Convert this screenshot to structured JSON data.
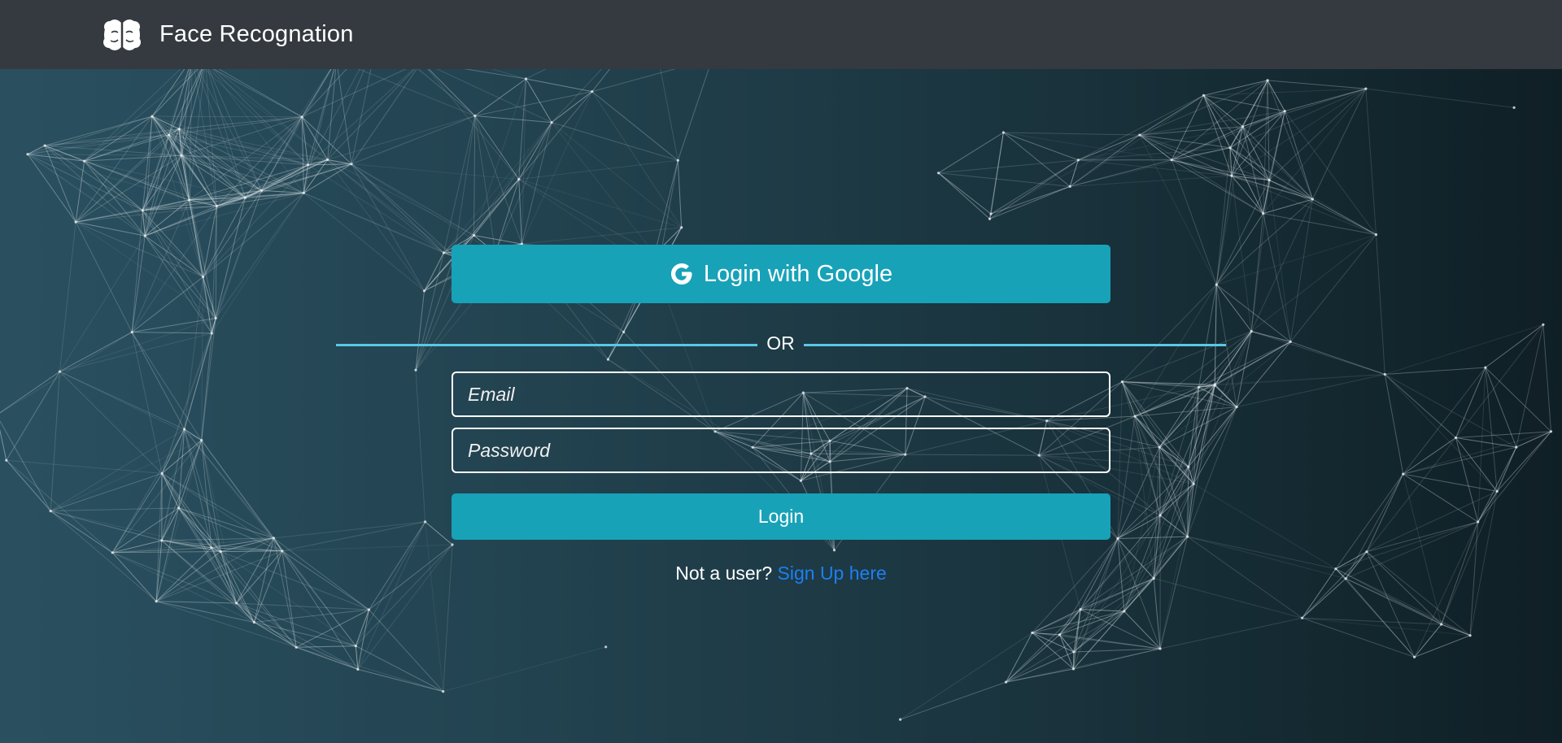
{
  "navbar": {
    "title": "Face Recognation",
    "icon": "brain-icon",
    "background": "#343a40"
  },
  "login_form": {
    "google_button_label": "Login with Google",
    "google_icon": "google-g-icon",
    "divider_text": "OR",
    "email_placeholder": "Email",
    "email_value": "",
    "password_placeholder": "Password",
    "password_value": "",
    "login_button_label": "Login",
    "signup_prompt": "Not a user?",
    "signup_link_label": "Sign Up here"
  },
  "colors": {
    "accent": "#17a2b8",
    "divider": "#5ac8e6",
    "link": "#1e7ff0",
    "text": "#ffffff"
  },
  "background": {
    "style": "particle-network"
  }
}
